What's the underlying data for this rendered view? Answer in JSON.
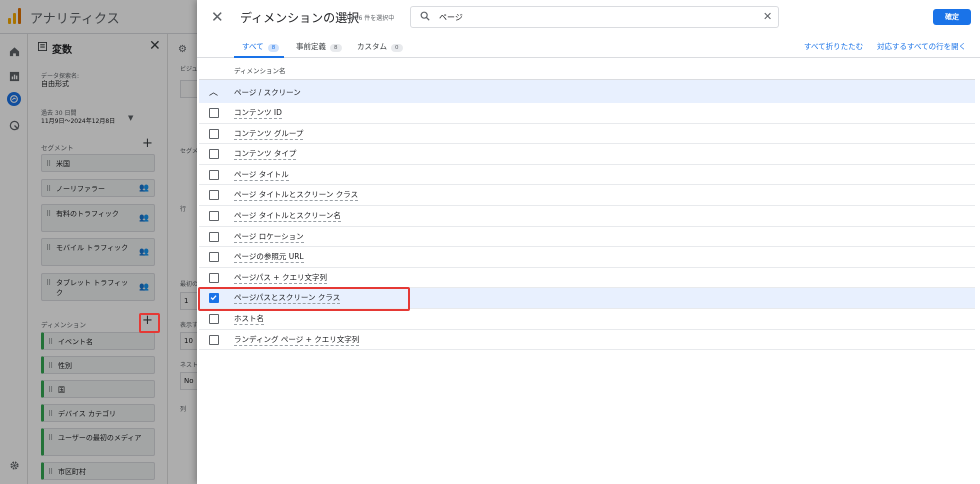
{
  "app": {
    "title": "アナリティクス"
  },
  "variables_panel": {
    "title": "変数",
    "exploration_name_label": "データ探索名:",
    "exploration_name": "自由形式",
    "date_label": "過去 30 日間",
    "date_range": "11月9日〜2024年12月8日",
    "segments_label": "セグメント",
    "segments": [
      {
        "label": "米国",
        "audience": false
      },
      {
        "label": "ノーリファラー",
        "audience": true
      },
      {
        "label": "有料のトラフィック",
        "audience": true
      },
      {
        "label": "モバイル トラフィック",
        "audience": true
      },
      {
        "label": "タブレット トラフィック",
        "audience": true
      }
    ],
    "dimensions_label": "ディメンション",
    "dimensions": [
      "イベント名",
      "性別",
      "国",
      "デバイス カテゴリ",
      "ユーザーの最初のメディア",
      "市区町村"
    ]
  },
  "settings_panel": {
    "labels": [
      "ビジュ",
      "セグメ",
      "行",
      "最初の",
      "表示す",
      "ネスト",
      "列"
    ],
    "values": [
      "1",
      "10",
      "No"
    ]
  },
  "dialog": {
    "title": "ディメンションの選択",
    "count": "7/356 件を選択中",
    "search_value": "ページ",
    "confirm_label": "確定",
    "tabs": [
      {
        "label": "すべて",
        "count": "8"
      },
      {
        "label": "事前定義",
        "count": "8"
      },
      {
        "label": "カスタム",
        "count": "0"
      }
    ],
    "collapse_all": "すべて折りたたむ",
    "expand_matching": "対応するすべての行を開く",
    "column_header": "ディメンション名",
    "group": "ページ / スクリーン",
    "items": [
      {
        "label": "コンテンツ ID",
        "checked": false
      },
      {
        "label": "コンテンツ グループ",
        "checked": false
      },
      {
        "label": "コンテンツ タイプ",
        "checked": false
      },
      {
        "label": "ページ タイトル",
        "checked": false
      },
      {
        "label": "ページ タイトルとスクリーン クラス",
        "checked": false
      },
      {
        "label": "ページ タイトルとスクリーン名",
        "checked": false
      },
      {
        "label": "ページ ロケーション",
        "checked": false
      },
      {
        "label": "ページの参照元 URL",
        "checked": false
      },
      {
        "label": "ページパス + クエリ文字列",
        "checked": false
      },
      {
        "label": "ページパスとスクリーン クラス",
        "checked": true
      },
      {
        "label": "ホスト名",
        "checked": false
      },
      {
        "label": "ランディング ページ + クエリ文字列",
        "checked": false
      }
    ]
  },
  "colors": {
    "accent": "#1a73e8",
    "highlight": "#e53935",
    "selected_row": "#e8f0fe"
  }
}
